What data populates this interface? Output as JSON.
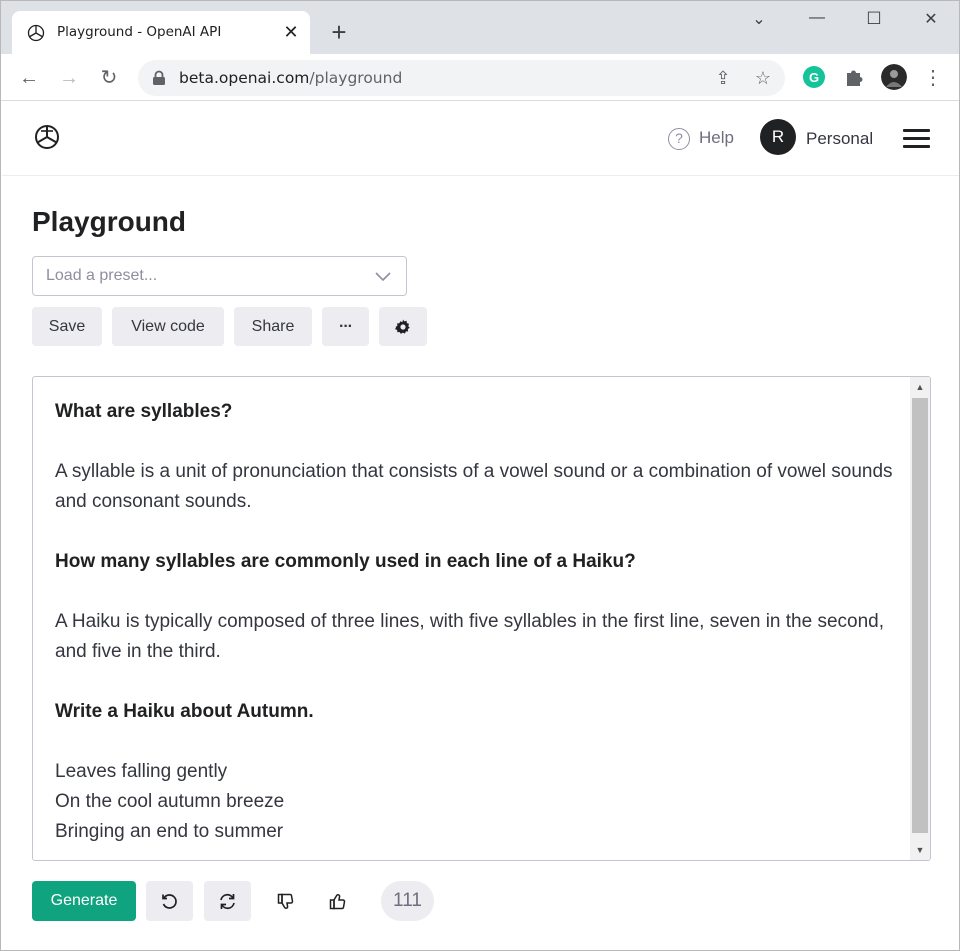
{
  "browser": {
    "tab_title": "Playground - OpenAI API",
    "new_tab": "+",
    "url_host": "beta.openai.com",
    "url_path": "/playground"
  },
  "header": {
    "help_label": "Help",
    "avatar_initial": "R",
    "account_label": "Personal"
  },
  "playground": {
    "title": "Playground",
    "preset_placeholder": "Load a preset...",
    "buttons": {
      "save": "Save",
      "view_code": "View code",
      "share": "Share",
      "more": "···"
    },
    "editor": {
      "q1": "What are syllables?",
      "a1": "A syllable is a unit of pronunciation that consists of a vowel sound or a combination of vowel sounds and consonant sounds.",
      "q2": "How many syllables are commonly used in each line of a Haiku?",
      "a2": "A Haiku is typically composed of three lines, with five syllables in the first line, seven in the second, and five in the third.",
      "q3": "Write a Haiku about Autumn.",
      "poem_line1": "Leaves falling gently",
      "poem_line2": "On the cool autumn breeze",
      "poem_line3": "Bringing an end to summer"
    },
    "generate_label": "Generate",
    "token_count": "111"
  },
  "colors": {
    "accent": "#10a37f",
    "button_bg": "#ececf1",
    "text": "#353740"
  }
}
